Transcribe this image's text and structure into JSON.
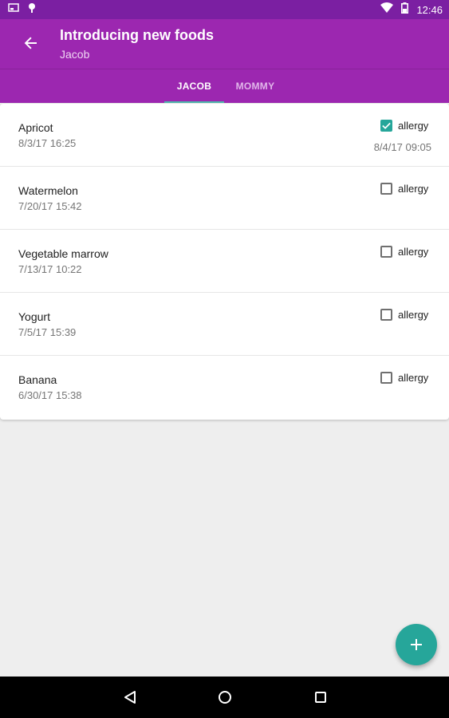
{
  "status_bar": {
    "time": "12:46",
    "icons": [
      "screenshot-icon",
      "location-pin-icon",
      "wifi-icon",
      "battery-icon"
    ]
  },
  "app_bar": {
    "title": "Introducing new foods",
    "subtitle": "Jacob",
    "back_icon": "arrow-back-icon"
  },
  "tabs": [
    {
      "label": "JACOB",
      "selected": true
    },
    {
      "label": "MOMMY",
      "selected": false
    }
  ],
  "foods": [
    {
      "name": "Apricot",
      "date": "8/3/17 16:25",
      "allergy_label": "allergy",
      "allergy_checked": true,
      "allergy_date": "8/4/17 09:05"
    },
    {
      "name": "Watermelon",
      "date": "7/20/17 15:42",
      "allergy_label": "allergy",
      "allergy_checked": false,
      "allergy_date": ""
    },
    {
      "name": "Vegetable marrow",
      "date": "7/13/17 10:22",
      "allergy_label": "allergy",
      "allergy_checked": false,
      "allergy_date": ""
    },
    {
      "name": "Yogurt",
      "date": "7/5/17 15:39",
      "allergy_label": "allergy",
      "allergy_checked": false,
      "allergy_date": ""
    },
    {
      "name": "Banana",
      "date": "6/30/17 15:38",
      "allergy_label": "allergy",
      "allergy_checked": false,
      "allergy_date": ""
    }
  ],
  "fab": {
    "icon": "plus-icon"
  },
  "nav_bar": {
    "icons": [
      "back-triangle-icon",
      "home-circle-icon",
      "recents-square-icon"
    ]
  },
  "colors": {
    "primary": "#9c27b0",
    "primary_dark": "#7b1fa2",
    "accent": "#26a69a",
    "tab_indicator": "#4db6ac"
  }
}
